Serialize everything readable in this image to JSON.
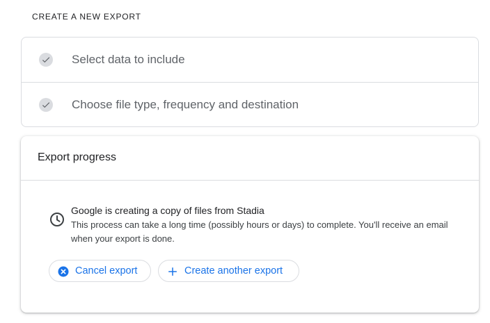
{
  "section_heading": "CREATE A NEW EXPORT",
  "steps": [
    {
      "label": "Select data to include",
      "icon": "check-icon",
      "status": "completed"
    },
    {
      "label": "Choose file type, frequency and destination",
      "icon": "check-icon",
      "status": "completed"
    }
  ],
  "progress": {
    "title": "Export progress",
    "status_icon": "clock-icon",
    "status_title": "Google is creating a copy of files from Stadia",
    "status_description": "This process can take a long time (possibly hours or days) to complete. You'll receive an email when your export is done."
  },
  "buttons": {
    "cancel_label": "Cancel export",
    "cancel_icon": "cancel-icon",
    "create_label": "Create another export",
    "create_icon": "plus-icon"
  },
  "colors": {
    "accent": "#1a73e8",
    "border": "#dadce0",
    "text_primary": "#202124",
    "text_secondary": "#5f6368"
  }
}
